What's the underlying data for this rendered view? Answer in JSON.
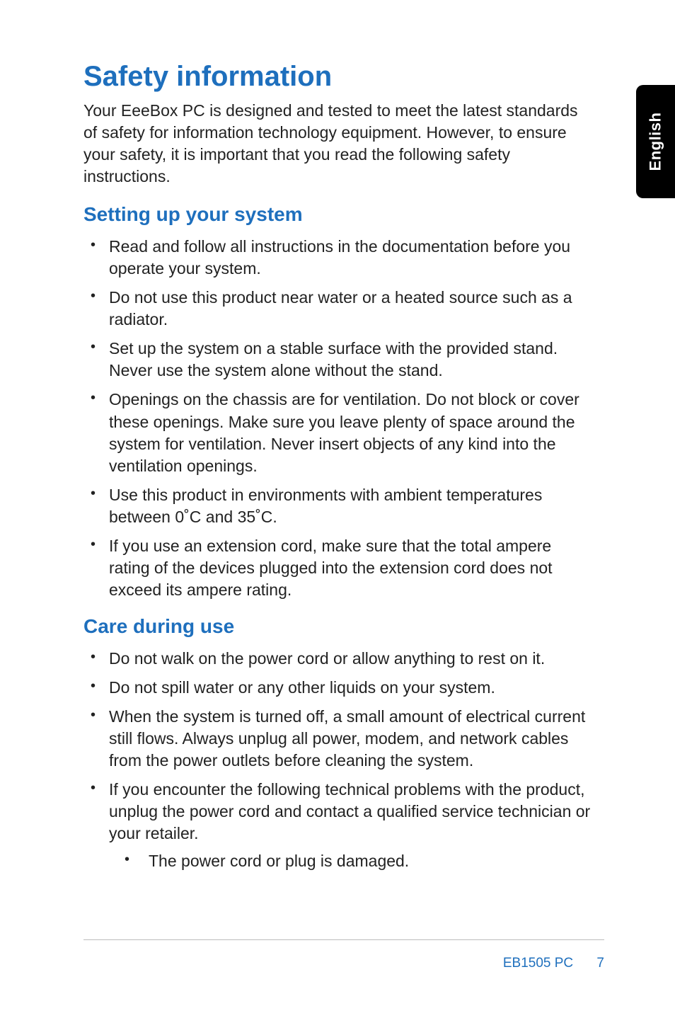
{
  "side_tab": {
    "label": "English"
  },
  "title": "Safety information",
  "intro": "Your EeeBox PC is designed and tested to meet the latest standards of safety for information technology equipment. However, to ensure your safety, it is important that you read the following safety instructions.",
  "section1": {
    "heading": "Setting up your system",
    "items": [
      "Read and follow all instructions in the documentation before you operate your system.",
      "Do not use this product near water or a heated source such as a radiator.",
      "Set up the system on a stable surface with the provided stand. Never use the system alone without the stand.",
      "Openings on the chassis are for ventilation. Do not block or cover these openings. Make sure you leave plenty of space around the system for ventilation. Never insert objects of any kind into the ventilation openings.",
      "Use this product in environments with ambient temperatures between 0˚C and 35˚C.",
      "If you use an extension cord, make sure that the total ampere rating of the devices plugged into the extension cord does not exceed its ampere rating."
    ]
  },
  "section2": {
    "heading": "Care during use",
    "items": [
      "Do not walk on the power cord or allow anything to rest on it.",
      "Do not spill water or any other liquids on your system.",
      "When the system is turned off, a small amount of electrical current still flows. Always unplug all power, modem, and network cables from the power outlets before cleaning the system.",
      "If you encounter the following technical problems with the product, unplug the power cord and contact a qualified service technician or your retailer."
    ],
    "sub_items": [
      "The power cord or plug is damaged."
    ]
  },
  "footer": {
    "model": "EB1505 PC",
    "page": "7"
  }
}
